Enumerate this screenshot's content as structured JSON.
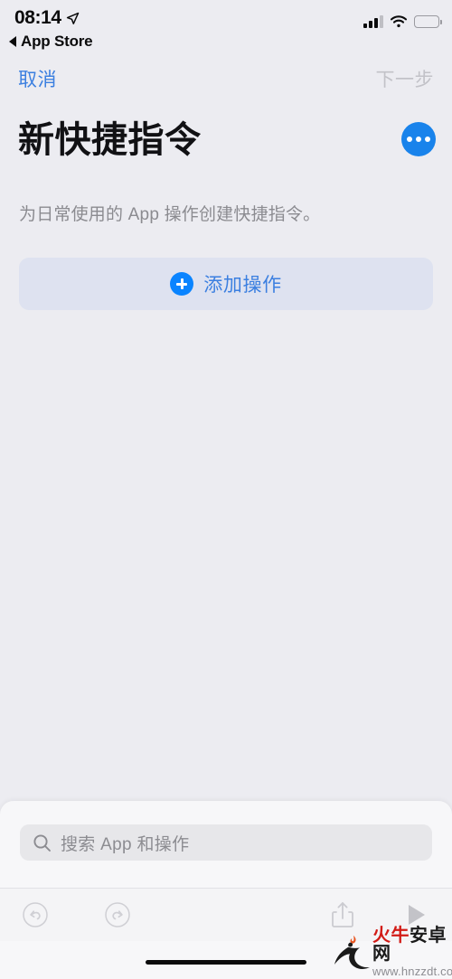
{
  "status_bar": {
    "time": "08:14",
    "location_icon": "location-arrow-icon",
    "back_app_label": "App Store",
    "back_icon": "back-triangle-icon",
    "signal_icon": "cellular-signal-icon",
    "wifi_icon": "wifi-icon",
    "battery_icon": "battery-full-icon"
  },
  "nav_bar": {
    "cancel_label": "取消",
    "next_label": "下一步",
    "cancel_color": "#3B7FE0",
    "next_color": "#C2C2C8"
  },
  "header": {
    "title": "新快捷指令",
    "more_icon": "ellipsis-circle-icon",
    "more_button_color": "#1983EB"
  },
  "main": {
    "subtitle": "为日常使用的 App 操作创建快捷指令。",
    "add_action": {
      "label": "添加操作",
      "icon": "plus-circle-icon",
      "background": "#DEE2F0",
      "text_color": "#3B7FE0"
    }
  },
  "sheet": {
    "search": {
      "placeholder": "搜索 App 和操作",
      "value": "",
      "icon": "search-icon",
      "background": "#E7E7EA"
    }
  },
  "toolbar": {
    "undo": {
      "name": "undo-icon",
      "label": "撤销"
    },
    "redo": {
      "name": "redo-icon",
      "label": "重做"
    },
    "share": {
      "name": "share-icon",
      "label": "共享"
    },
    "play": {
      "name": "play-icon",
      "label": "运行"
    }
  },
  "watermark": {
    "brand_red": "火牛",
    "brand_black": "安卓网",
    "url": "www.hnzzdt.com",
    "logo_icon": "bull-flame-logo-icon"
  },
  "home_indicator": "home-indicator",
  "colors": {
    "background": "#ECECF1",
    "sheet_background": "#F7F7F9",
    "accent": "#0A84FF"
  }
}
